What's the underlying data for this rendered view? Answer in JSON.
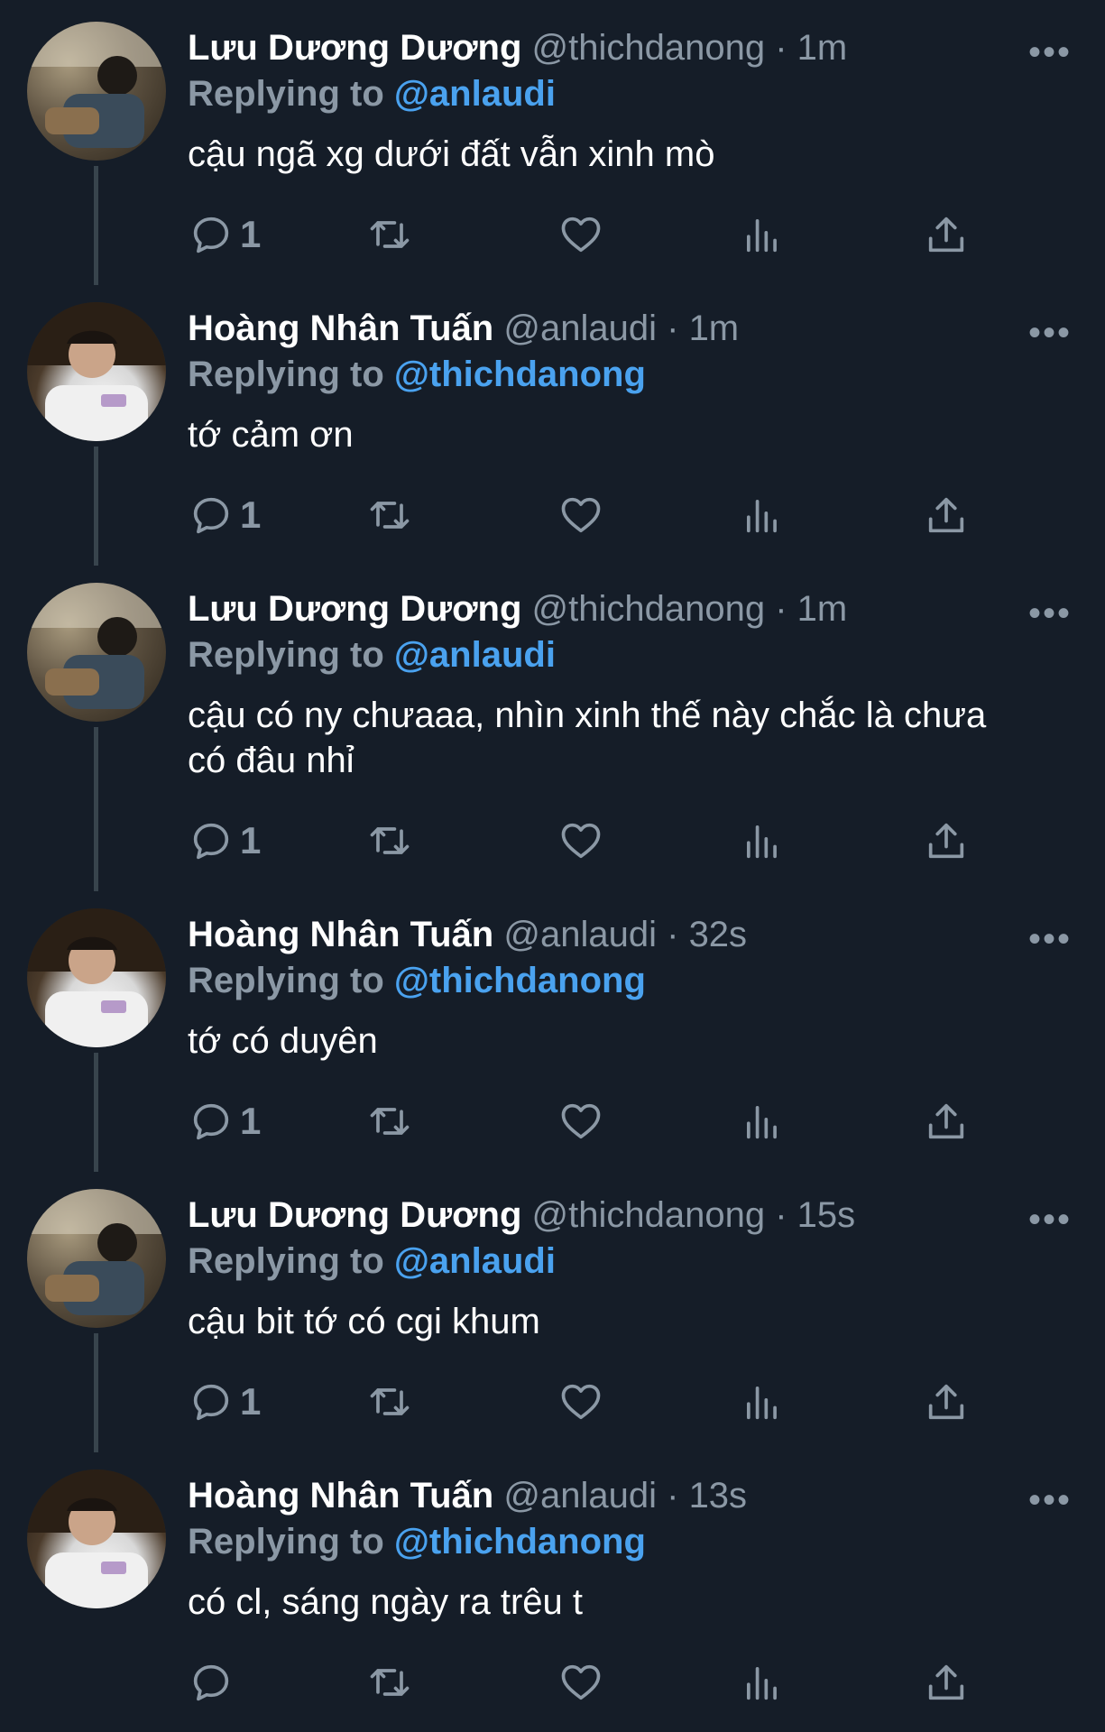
{
  "thread": [
    {
      "name": "Lưu Dương Dương",
      "handle": "@thichdanong",
      "dot": "·",
      "time": "1m",
      "replying_label": "Replying to",
      "replying_to": "@anlaudi",
      "text": "cậu ngã xg dưới đất vẫn xinh mò",
      "reply_count": "1"
    },
    {
      "name": "Hoàng Nhân Tuấn",
      "handle": "@anlaudi",
      "dot": "·",
      "time": "1m",
      "replying_label": "Replying to",
      "replying_to": "@thichdanong",
      "text": "tớ cảm ơn",
      "reply_count": "1"
    },
    {
      "name": "Lưu Dương Dương",
      "handle": "@thichdanong",
      "dot": "·",
      "time": "1m",
      "replying_label": "Replying to",
      "replying_to": "@anlaudi",
      "text": "cậu có ny chưaaa, nhìn xinh thế này chắc là chưa có đâu nhỉ",
      "reply_count": "1"
    },
    {
      "name": "Hoàng Nhân Tuấn",
      "handle": "@anlaudi",
      "dot": "·",
      "time": "32s",
      "replying_label": "Replying to",
      "replying_to": "@thichdanong",
      "text": "tớ có duyên",
      "reply_count": "1"
    },
    {
      "name": "Lưu Dương Dương",
      "handle": "@thichdanong",
      "dot": "·",
      "time": "15s",
      "replying_label": "Replying to",
      "replying_to": "@anlaudi",
      "text": "cậu bit tớ có cgi khum",
      "reply_count": "1"
    },
    {
      "name": "Hoàng Nhân Tuấn",
      "handle": "@anlaudi",
      "dot": "·",
      "time": "13s",
      "replying_label": "Replying to",
      "replying_to": "@thichdanong",
      "text": "có cl, sáng ngày ra trêu t",
      "reply_count": ""
    }
  ],
  "icons": {
    "more": "more-horizontal-icon",
    "reply": "reply-bubble-icon",
    "retweet": "retweet-icon",
    "like": "heart-icon",
    "stats": "analytics-bars-icon",
    "share": "share-upload-icon"
  },
  "colors": {
    "background": "#151d28",
    "muted": "#8b98a5",
    "link": "#4aa2ef",
    "thread_line": "#38444d"
  }
}
